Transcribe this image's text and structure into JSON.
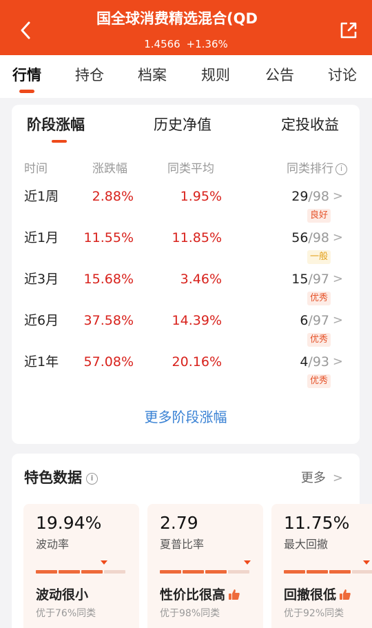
{
  "header": {
    "title": "国全球消费精选混合(QD",
    "nav": "1.4566",
    "change": "+1.36%"
  },
  "tabs": [
    "行情",
    "持仓",
    "档案",
    "规则",
    "公告",
    "讨论"
  ],
  "section_tabs": [
    "阶段涨幅",
    "历史净值",
    "定投收益"
  ],
  "table": {
    "headers": [
      "时间",
      "涨跌幅",
      "同类平均",
      "同类排行"
    ],
    "rows": [
      {
        "period": "近1周",
        "change": "2.88%",
        "avg": "1.95%",
        "rank": "29",
        "total": "/98",
        "level": "良好",
        "level_color": "red"
      },
      {
        "period": "近1月",
        "change": "11.55%",
        "avg": "11.85%",
        "rank": "56",
        "total": "/98",
        "level": "一般",
        "level_color": "yellow"
      },
      {
        "period": "近3月",
        "change": "15.68%",
        "avg": "3.46%",
        "rank": "15",
        "total": "/97",
        "level": "优秀",
        "level_color": "red"
      },
      {
        "period": "近6月",
        "change": "37.58%",
        "avg": "14.39%",
        "rank": "6",
        "total": "/97",
        "level": "优秀",
        "level_color": "red"
      },
      {
        "period": "近1年",
        "change": "57.08%",
        "avg": "20.16%",
        "rank": "4",
        "total": "/93",
        "level": "优秀",
        "level_color": "red"
      }
    ],
    "more_link": "更多阶段涨幅"
  },
  "features": {
    "title": "特色数据",
    "more": "更多",
    "items": [
      {
        "value": "19.94%",
        "label": "波动率",
        "verdict": "波动很小",
        "rank_text": "优于76%同类",
        "thumb": false,
        "percentile": 0.76
      },
      {
        "value": "2.79",
        "label": "夏普比率",
        "verdict": "性价比很高",
        "rank_text": "优于98%同类",
        "thumb": true,
        "percentile": 0.98
      },
      {
        "value": "11.75%",
        "label": "最大回撤",
        "verdict": "回撤很低",
        "rank_text": "优于92%同类",
        "thumb": true,
        "percentile": 0.92
      }
    ]
  },
  "colors": {
    "brand": "#ee4a1b",
    "up": "#d8221c",
    "link": "#3a82d4"
  }
}
